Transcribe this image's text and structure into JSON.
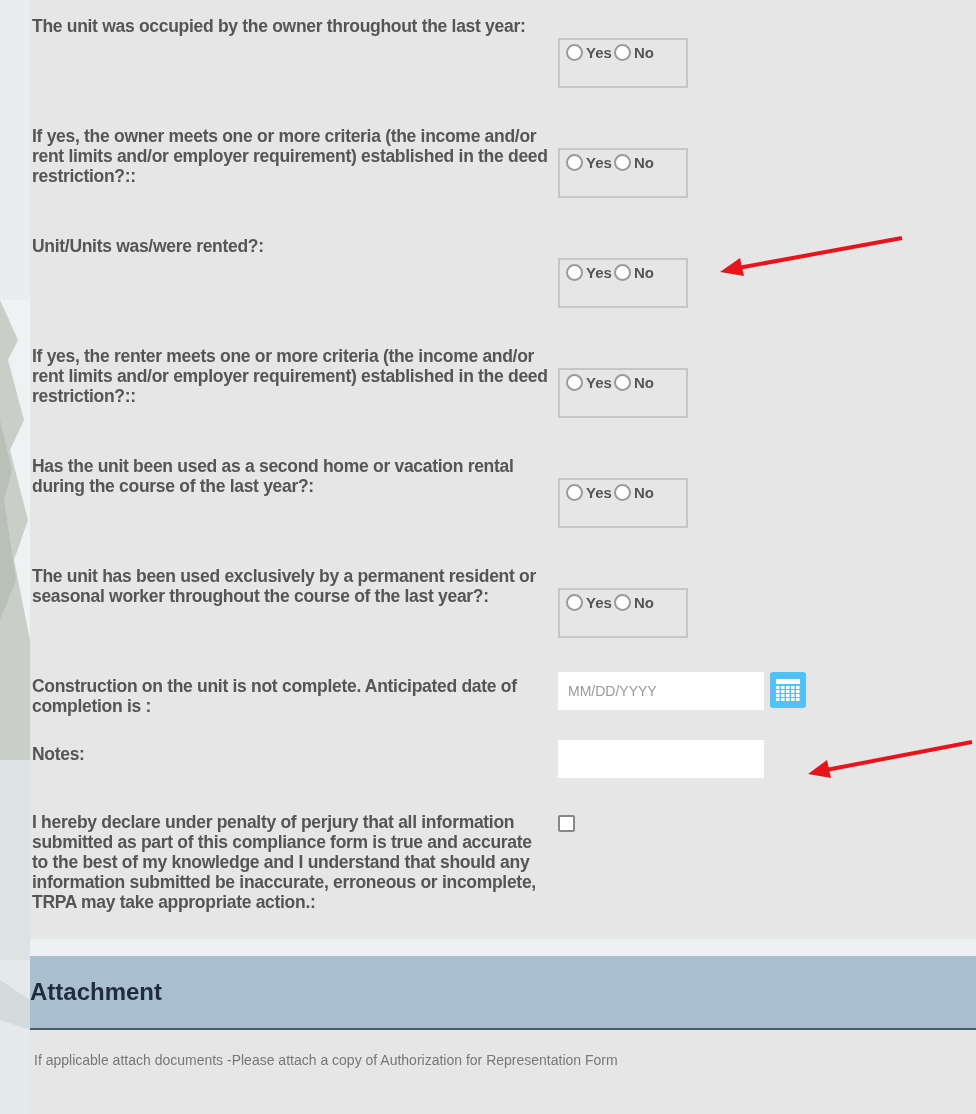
{
  "questions": [
    {
      "kind": "radio",
      "label": "The unit was occupied by the owner throughout the last year:",
      "options": [
        {
          "label": "Yes",
          "selected": false
        },
        {
          "label": "No",
          "selected": false
        }
      ]
    },
    {
      "kind": "radio",
      "label": "If yes, the owner meets one or more criteria (the income and/or rent limits and/or employer requirement) established in the deed restriction?::",
      "options": [
        {
          "label": "Yes",
          "selected": false
        },
        {
          "label": "No",
          "selected": false
        }
      ]
    },
    {
      "kind": "radio",
      "label": "Unit/Units was/were rented?:",
      "options": [
        {
          "label": "Yes",
          "selected": false
        },
        {
          "label": "No",
          "selected": false
        }
      ]
    },
    {
      "kind": "radio",
      "label": "If yes, the renter meets one or more criteria (the income and/or rent limits and/or employer requirement) established in the deed restriction?::",
      "options": [
        {
          "label": "Yes",
          "selected": false
        },
        {
          "label": "No",
          "selected": false
        }
      ]
    },
    {
      "kind": "radio",
      "label": "Has the unit been used as a second home or vacation rental during the course of the last year?:",
      "options": [
        {
          "label": "Yes",
          "selected": false
        },
        {
          "label": "No",
          "selected": false
        }
      ]
    },
    {
      "kind": "radio",
      "label": "The unit has been used exclusively by a permanent resident or seasonal worker throughout the course of the last year?:",
      "options": [
        {
          "label": "Yes",
          "selected": false
        },
        {
          "label": "No",
          "selected": false
        }
      ]
    },
    {
      "kind": "date",
      "label": "Construction on the unit is not complete. Anticipated date of completion is :",
      "placeholder": "MM/DD/YYYY"
    },
    {
      "kind": "text",
      "label": "Notes:"
    },
    {
      "kind": "checkbox",
      "label": "I hereby declare under penalty of perjury that all information submitted as part of this compliance form is true and accurate to the best of my knowledge and I understand that should any information submitted be inaccurate, erroneous or incomplete, TRPA may take appropriate action.:",
      "checked": false
    }
  ],
  "attachment": {
    "title": "Attachment",
    "note": "If applicable attach documents -Please attach a copy of Authorization for Representation Form"
  }
}
